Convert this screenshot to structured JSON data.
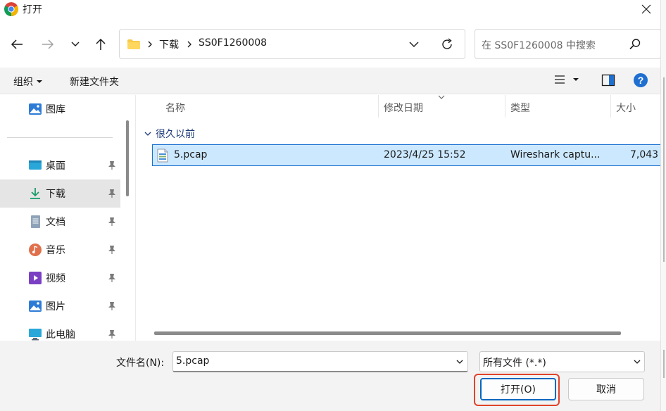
{
  "window": {
    "title": "打开"
  },
  "address": {
    "breadcrumbs": [
      "下载",
      "SS0F1260008"
    ]
  },
  "search": {
    "placeholder": "在 SS0F1260008 中搜索"
  },
  "toolbar": {
    "organize_label": "组织",
    "new_folder_label": "新建文件夹"
  },
  "sidebar": {
    "items": [
      {
        "label": "图库",
        "icon": "gallery-icon",
        "pinned": false
      },
      {
        "label": "桌面",
        "icon": "desktop-icon",
        "pinned": true
      },
      {
        "label": "下载",
        "icon": "download-icon",
        "pinned": true,
        "selected": true
      },
      {
        "label": "文档",
        "icon": "document-icon",
        "pinned": true
      },
      {
        "label": "音乐",
        "icon": "music-icon",
        "pinned": true
      },
      {
        "label": "视频",
        "icon": "video-icon",
        "pinned": true
      },
      {
        "label": "图片",
        "icon": "picture-icon",
        "pinned": true
      },
      {
        "label": "此电脑",
        "icon": "computer-icon",
        "pinned": true
      }
    ]
  },
  "filelist": {
    "columns": [
      "名称",
      "修改日期",
      "类型",
      "大小"
    ],
    "group_label": "很久以前",
    "files": [
      {
        "name": "5.pcap",
        "modified": "2023/4/25 15:52",
        "type": "Wireshark captu...",
        "size": "7,043"
      }
    ]
  },
  "bottom": {
    "filename_label": "文件名(N):",
    "filename_value": "5.pcap",
    "filetype_value": "所有文件 (*.*)",
    "open_label": "打开(O)",
    "cancel_label": "取消"
  },
  "colors": {
    "accent": "#0067c0",
    "selection_bg": "#cce8ff",
    "highlight_box": "#e0432b"
  }
}
